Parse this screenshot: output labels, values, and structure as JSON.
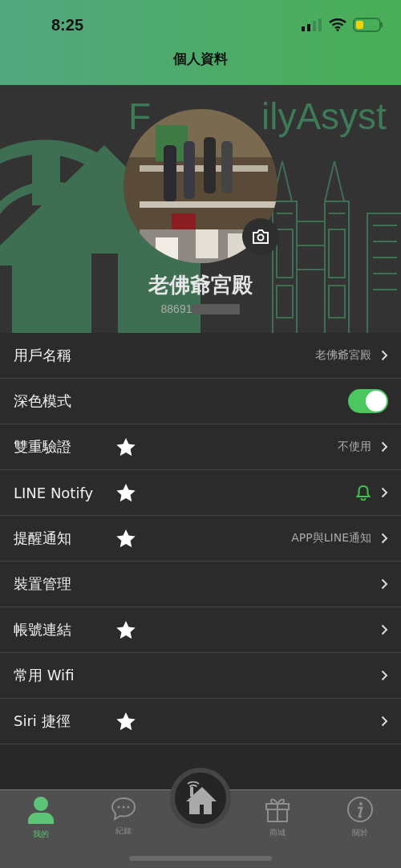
{
  "status_bar": {
    "time": "8:25"
  },
  "header": {
    "title": "個人資料"
  },
  "profile": {
    "brand_text": [
      "F",
      "ilyAsyst"
    ],
    "name": "老佛爺宮殿",
    "phone": "88691",
    "phone_obscured": true
  },
  "settings": [
    {
      "kind": "value",
      "label": "用戶名稱",
      "starred": false,
      "value": "老佛爺宮殿"
    },
    {
      "kind": "toggle",
      "label": "深色模式",
      "starred": false,
      "on": true
    },
    {
      "kind": "value",
      "label": "雙重驗證",
      "starred": true,
      "value": "不使用"
    },
    {
      "kind": "bell",
      "label": "LINE Notify",
      "starred": true
    },
    {
      "kind": "value",
      "label": "提醒通知",
      "starred": true,
      "value": "APP與LINE通知"
    },
    {
      "kind": "link",
      "label": "裝置管理",
      "starred": false
    },
    {
      "kind": "link",
      "label": "帳號連結",
      "starred": true
    },
    {
      "kind": "link",
      "label": "常用 Wifi",
      "starred": false
    },
    {
      "kind": "link",
      "label": "Siri 捷徑",
      "starred": true
    }
  ],
  "tab_bar": [
    {
      "kind": "person",
      "label": "我的",
      "selected": true
    },
    {
      "kind": "chat",
      "label": "紀錄",
      "selected": false
    },
    {
      "kind": "home",
      "selected": false
    },
    {
      "kind": "gift",
      "label": "商城",
      "selected": false
    },
    {
      "kind": "info",
      "label": "關於",
      "selected": false
    }
  ]
}
